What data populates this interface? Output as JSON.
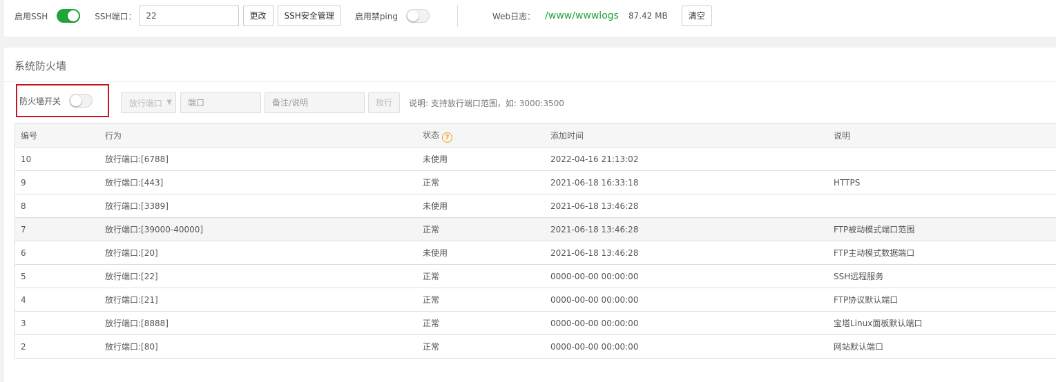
{
  "ssh": {
    "enable_label": "启用SSH",
    "enabled": true,
    "port_label": "SSH端口：",
    "port_value": "22",
    "change_button": "更改",
    "manage_button": "SSH安全管理",
    "ping_label": "启用禁ping",
    "ping_enabled": false
  },
  "weblog": {
    "label": "Web日志：",
    "path": "/www/wwwlogs",
    "size": "87.42 MB",
    "clear_button": "清空"
  },
  "firewall": {
    "title": "系统防火墙",
    "switch_label": "防火墙开关",
    "switch_enabled": false,
    "action_select": "放行端口",
    "port_placeholder": "端口",
    "note_placeholder": "备注/说明",
    "submit_button": "放行",
    "hint": "说明: 支持放行端口范围，如: 3000:3500"
  },
  "table": {
    "headers": {
      "id": "编号",
      "action": "行为",
      "status": "状态",
      "time": "添加时间",
      "note": "说明"
    },
    "rows": [
      {
        "id": "10",
        "action": "放行端口:[6788]",
        "status": "未使用",
        "time": "2022-04-16 21:13:02",
        "note": ""
      },
      {
        "id": "9",
        "action": "放行端口:[443]",
        "status": "正常",
        "time": "2021-06-18 16:33:18",
        "note": "HTTPS"
      },
      {
        "id": "8",
        "action": "放行端口:[3389]",
        "status": "未使用",
        "time": "2021-06-18 13:46:28",
        "note": ""
      },
      {
        "id": "7",
        "action": "放行端口:[39000-40000]",
        "status": "正常",
        "time": "2021-06-18 13:46:28",
        "note": "FTP被动模式端口范围"
      },
      {
        "id": "6",
        "action": "放行端口:[20]",
        "status": "未使用",
        "time": "2021-06-18 13:46:28",
        "note": "FTP主动模式数据端口"
      },
      {
        "id": "5",
        "action": "放行端口:[22]",
        "status": "正常",
        "time": "0000-00-00 00:00:00",
        "note": "SSH远程服务"
      },
      {
        "id": "4",
        "action": "放行端口:[21]",
        "status": "正常",
        "time": "0000-00-00 00:00:00",
        "note": "FTP协议默认端口"
      },
      {
        "id": "3",
        "action": "放行端口:[8888]",
        "status": "正常",
        "time": "0000-00-00 00:00:00",
        "note": "宝塔Linux面板默认端口"
      },
      {
        "id": "2",
        "action": "放行端口:[80]",
        "status": "正常",
        "time": "0000-00-00 00:00:00",
        "note": "网站默认端口"
      }
    ]
  },
  "colors": {
    "accent_green": "#20a53a",
    "path_green": "#20a53a",
    "highlight_red": "#c9151e",
    "help_orange": "#f39c12"
  },
  "icons": {
    "help": "question-circle-icon",
    "caret": "chevron-down-icon"
  }
}
